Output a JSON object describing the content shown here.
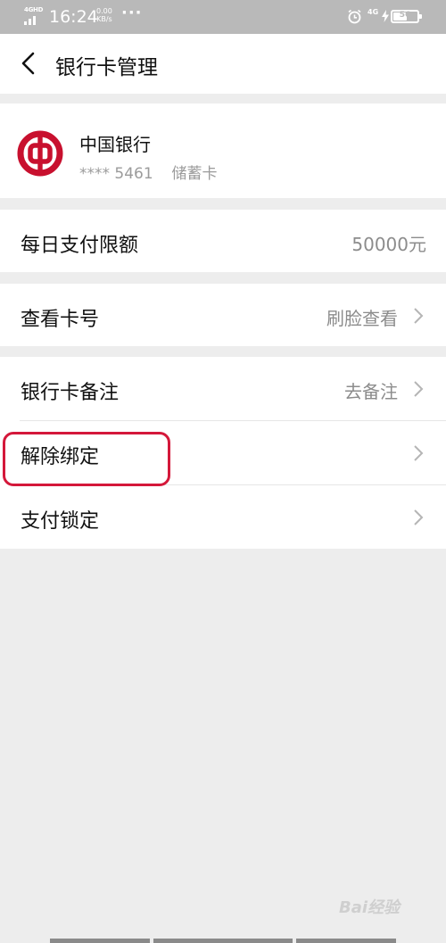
{
  "status_bar": {
    "network": "4GHD",
    "time": "16:24",
    "speed_value": "0.00",
    "speed_unit": "KB/s",
    "more": "···",
    "lte": "4G",
    "battery": "56"
  },
  "header": {
    "title": "银行卡管理"
  },
  "card": {
    "bank_name": "中国银行",
    "masked_number": "**** 5461",
    "card_type": "储蓄卡"
  },
  "rows": {
    "daily_limit": {
      "label": "每日支付限额",
      "value": "50000元"
    },
    "view_number": {
      "label": "查看卡号",
      "value": "刷脸查看"
    },
    "card_note": {
      "label": "银行卡备注",
      "value": "去备注"
    },
    "unbind": {
      "label": "解除绑定"
    },
    "pay_lock": {
      "label": "支付锁定"
    }
  },
  "watermark": "Bai经验",
  "colors": {
    "status_bar_bg": "#b9b9b9",
    "page_bg": "#ededed",
    "bank_red": "#c8102e",
    "highlight_red": "#d4183a"
  }
}
